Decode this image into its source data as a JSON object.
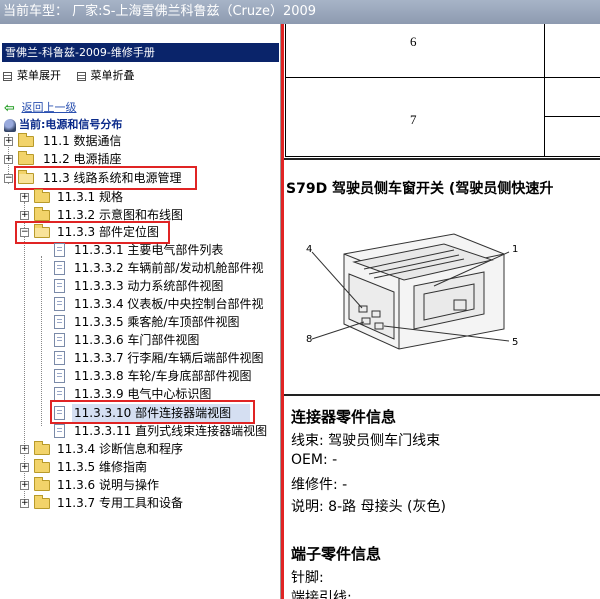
{
  "titlebar": {
    "text": "当前车型：  厂家:S-上海雪佛兰科鲁兹（Cruze）2009"
  },
  "left": {
    "manual_title": "雪佛兰-科鲁兹-2009-维修手册",
    "expand_all": "菜单展开",
    "collapse_all": "菜单折叠",
    "back_link": "返回上一级",
    "current": "当前:电源和信号分布",
    "tree": [
      {
        "label": "11.1 数据通信",
        "expander": "+"
      },
      {
        "label": "11.2 电源插座",
        "expander": "+"
      },
      {
        "label": "11.3 线路系统和电源管理",
        "expander": "−"
      },
      {
        "label": "11.3.1 规格",
        "expander": "+"
      },
      {
        "label": "11.3.2 示意图和布线图",
        "expander": "+"
      },
      {
        "label": "11.3.3 部件定位图",
        "expander": "−"
      },
      {
        "label": "11.3.3.1 主要电气部件列表"
      },
      {
        "label": "11.3.3.2 车辆前部/发动机舱部件视"
      },
      {
        "label": "11.3.3.3 动力系统部件视图"
      },
      {
        "label": "11.3.3.4 仪表板/中央控制台部件视"
      },
      {
        "label": "11.3.3.5 乘客舱/车顶部件视图"
      },
      {
        "label": "11.3.3.6 车门部件视图"
      },
      {
        "label": "11.3.3.7 行李厢/车辆后端部件视图"
      },
      {
        "label": "11.3.3.8 车轮/车身底部部件视图"
      },
      {
        "label": "11.3.3.9 电气中心标识图"
      },
      {
        "label": "11.3.3.10 部件连接器端视图"
      },
      {
        "label": "11.3.3.11 直列式线束连接器端视图"
      },
      {
        "label": "11.3.4 诊断信息和程序",
        "expander": "+"
      },
      {
        "label": "11.3.5 维修指南",
        "expander": "+"
      },
      {
        "label": "11.3.6 说明与操作",
        "expander": "+"
      },
      {
        "label": "11.3.7 专用工具和设备",
        "expander": "+"
      }
    ]
  },
  "right": {
    "table_row_6": "6",
    "table_row_7": "7",
    "section_title": "S79D 驾驶员侧车窗开关 (驾驶员侧快速升",
    "diagram": {
      "pin_4": "4",
      "pin_1": "1",
      "pin_8": "8",
      "pin_5": "5"
    },
    "connector_heading": "连接器零件信息",
    "harness": "线束: 驾驶员侧车门线束",
    "oem": "OEM: -",
    "service": "维修件: -",
    "description": "说明: 8-路 母接头 (灰色)",
    "terminal_heading": "端子零件信息",
    "pin": "针脚:",
    "terminal_lead": "端接引线:"
  }
}
